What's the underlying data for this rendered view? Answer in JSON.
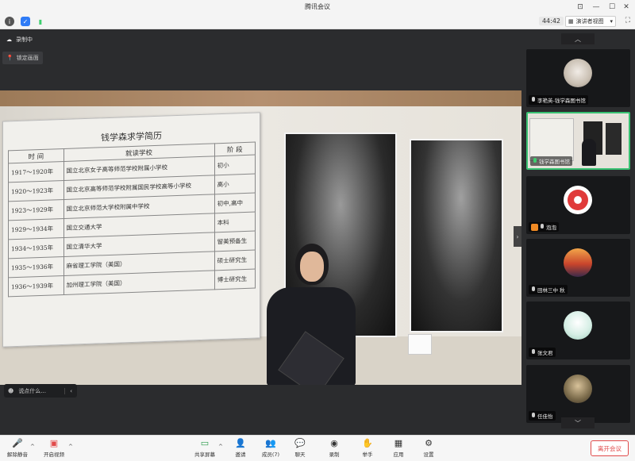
{
  "window": {
    "title": "腾讯会议"
  },
  "infobar": {
    "timer": "44:42",
    "view_label": "演讲者视图"
  },
  "main": {
    "recording_label": "录制中",
    "pin_label": "锁定画面",
    "chat_placeholder": "说点什么..."
  },
  "board": {
    "title": "钱学森求学简历",
    "headers": [
      "时  间",
      "就读学校",
      "阶  段"
    ],
    "rows": [
      [
        "1917～1920年",
        "国立北京女子高等师范学校附属小学校",
        "初小"
      ],
      [
        "1920～1923年",
        "国立北京高等师范学校附属国民学校高等小学校",
        "高小"
      ],
      [
        "1923～1929年",
        "国立北京师范大学校附属中学校",
        "初中,高中"
      ],
      [
        "1929～1934年",
        "国立交通大学",
        "本科"
      ],
      [
        "1934～1935年",
        "国立清华大学",
        "留美预备生"
      ],
      [
        "1935～1936年",
        "麻省理工学院（美国）",
        "硕士研究生"
      ],
      [
        "1936～1939年",
        "加州理工学院（美国）",
        "博士研究生"
      ]
    ]
  },
  "participants": [
    {
      "name": "李艳英-钱学森图书馆",
      "mic": "muted",
      "avatar": "cat-avatar"
    },
    {
      "name": "钱学森图书馆",
      "mic": "on",
      "avatar": "video-feed",
      "active": true
    },
    {
      "name": "泡泡",
      "mic": "muted",
      "avatar": "flower-avatar",
      "badge": "host"
    },
    {
      "name": "田林三中 秋",
      "mic": "muted",
      "avatar": "sunset-avatar"
    },
    {
      "name": "张文君",
      "mic": "muted",
      "avatar": "cartoon-avatar"
    },
    {
      "name": "任佳怡",
      "mic": "muted",
      "avatar": "photo-avatar"
    }
  ],
  "toolbar": {
    "unmute_label": "解除静音",
    "video_label": "开启视频",
    "share_label": "共享屏幕",
    "invite_label": "邀请",
    "members_label": "成员(7)",
    "chat_label": "聊天",
    "record_label": "录制",
    "hand_label": "举手",
    "apps_label": "应用",
    "settings_label": "设置",
    "leave_label": "离开会议"
  },
  "colors": {
    "active_border": "#38c172",
    "leave": "#e14a4a",
    "mic_on": "#3ecf6f"
  }
}
